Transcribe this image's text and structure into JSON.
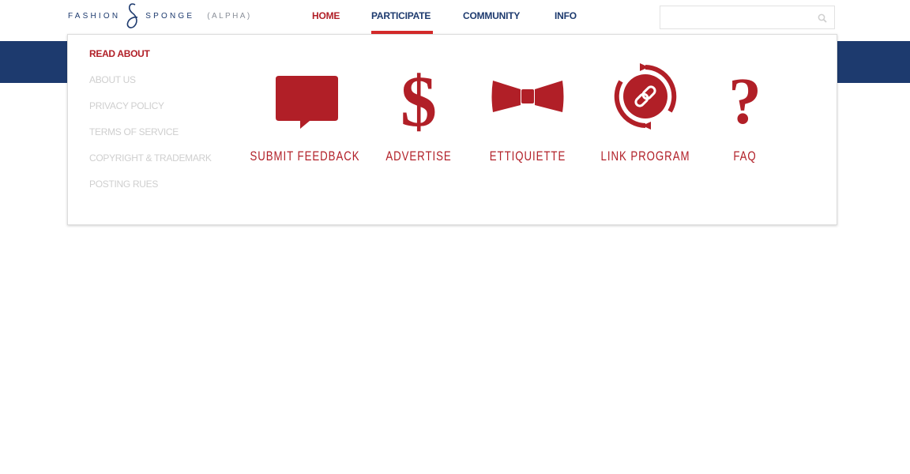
{
  "header": {
    "logo": {
      "word_left": "FASHION",
      "word_right": "SPONGE",
      "tag": "(ALPHA)"
    },
    "nav": [
      {
        "label": "HOME"
      },
      {
        "label": "PARTICIPATE"
      },
      {
        "label": "COMMUNITY"
      },
      {
        "label": "INFO"
      }
    ],
    "search": {
      "value": "",
      "placeholder": ""
    }
  },
  "dropdown": {
    "heading": "READ ABOUT",
    "links": [
      "ABOUT  US",
      "PRIVACY POLICY",
      "TERMS OF SERVICE",
      "COPYRIGHT & TRADEMARK",
      "POSTING RUES"
    ],
    "tiles": [
      {
        "label": "SUBMIT FEEDBACK",
        "icon": "speech-bubble-icon"
      },
      {
        "label": "ADVERTISE",
        "icon": "dollar-icon"
      },
      {
        "label": "ETTIQUIETTE",
        "icon": "bowtie-icon"
      },
      {
        "label": "LINK PROGRAM",
        "icon": "link-cycle-icon"
      },
      {
        "label": "FAQ",
        "icon": "question-mark-icon"
      }
    ]
  },
  "colors": {
    "brand_navy": "#1d3a6e",
    "accent_red": "#b11f27",
    "active_underline": "#d42a2a",
    "muted_link": "#cfcfcf"
  }
}
